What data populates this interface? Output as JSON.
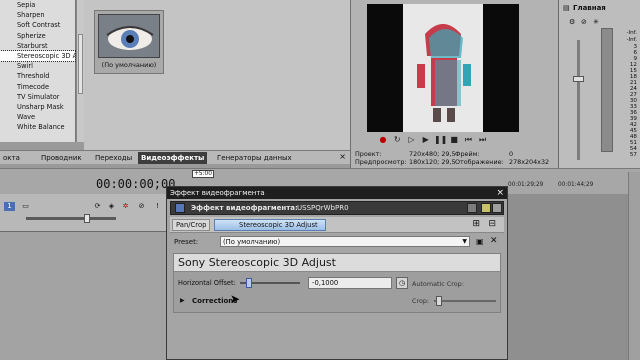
{
  "effects": {
    "items": [
      "Sepia",
      "Sharpen",
      "Soft Contrast",
      "Spherize",
      "Starburst",
      "Stereoscopic 3D A",
      "Swirl",
      "Threshold",
      "Timecode",
      "TV Simulator",
      "Unsharp Mask",
      "Wave",
      "White Balance"
    ],
    "selected_index": 5
  },
  "preset_tile": {
    "label": "(По умолчанию)"
  },
  "tabs": [
    "окта",
    "Проводник",
    "Переходы",
    "Видеоэффекты",
    "Генераторы данных"
  ],
  "preview": {
    "info": {
      "project_k": "Проект:",
      "project_v": "720x480; 29,5",
      "preview_k": "Предпросмотр:",
      "preview_v": "180x120; 29,5",
      "frame_k": "Фрейм:",
      "frame_v": "0",
      "display_k": "Отображение:",
      "display_v": "278x204x32"
    }
  },
  "mixer": {
    "title": "Главная",
    "scale": [
      "-Inf.",
      "-Inf.",
      "3",
      "6",
      "9",
      "12",
      "15",
      "18",
      "21",
      "24",
      "27",
      "30",
      "33",
      "36",
      "39",
      "42",
      "45",
      "48",
      "51",
      "54",
      "57"
    ]
  },
  "timeline": {
    "timecode": "00:00:00;00",
    "marker": "+5:00",
    "ticks": [
      "00:01:29;29",
      "00:01:44;29"
    ]
  },
  "dialog": {
    "title": "Эффект видеофрагмента",
    "close": "×",
    "header_label": "Эффект видеофрагмента:",
    "header_value": "USSPQrWbPR0",
    "chain": {
      "pan": "Pan/Crop",
      "stereo": "Stereoscopic 3D Adjust"
    },
    "preset_label": "Preset:",
    "preset_value": "(По умолчанию)",
    "plugin_name": "Sony Stereoscopic 3D Adjust",
    "h_label": "Horizontal Offset:",
    "h_value": "-0,1000",
    "auto_crop": "Automatic Crop:",
    "corrections": "Corrections",
    "crop_label": "Crop:"
  },
  "colors": {
    "dialog_title_bg": "#1f1f1f",
    "chip_accent": "#9dbfe6",
    "active_tab": "#3d3d3d"
  }
}
